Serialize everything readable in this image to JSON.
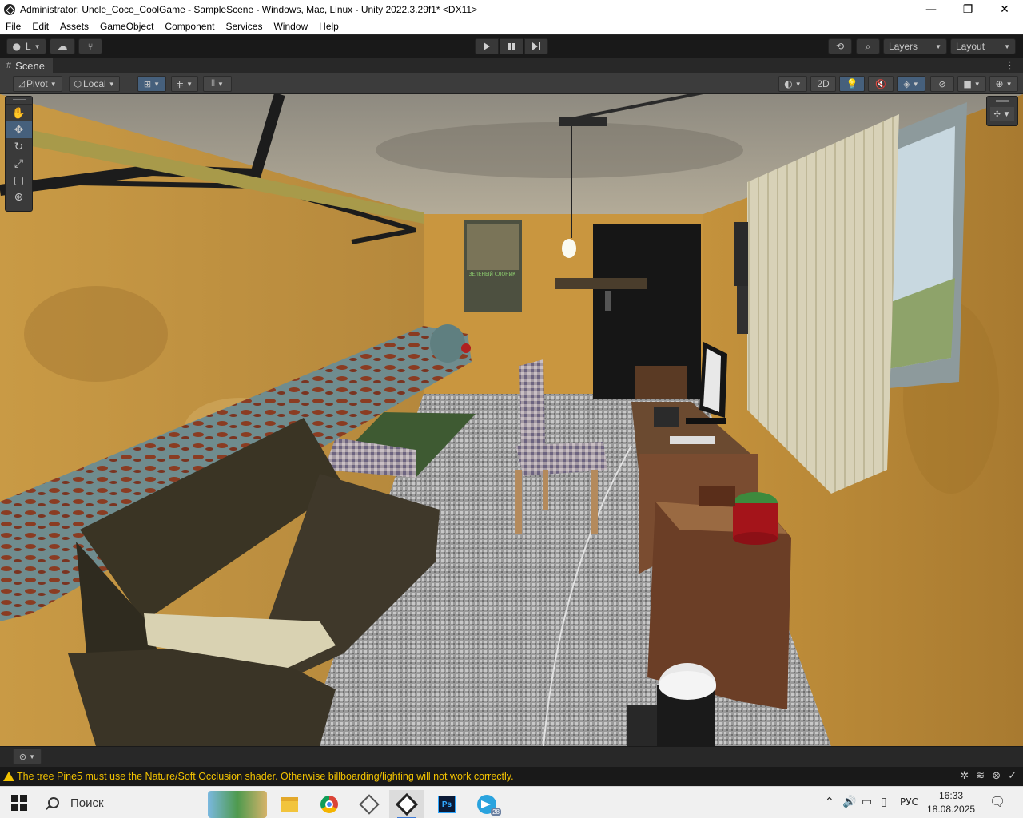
{
  "window": {
    "title": "Administrator: Uncle_Coco_CoolGame - SampleScene - Windows, Mac, Linux - Unity 2022.3.29f1* <DX11>",
    "minimize": "—",
    "maximize": "❐",
    "close": "✕"
  },
  "menu": [
    "File",
    "Edit",
    "Assets",
    "GameObject",
    "Component",
    "Services",
    "Window",
    "Help"
  ],
  "toolbar": {
    "account_label": "L",
    "layers_label": "Layers",
    "layout_label": "Layout"
  },
  "scene_tab": {
    "label": "Scene"
  },
  "scene_toolbar": {
    "pivot_label": "Pivot",
    "local_label": "Local",
    "mode_2d_label": "2D"
  },
  "status": {
    "warning": "The tree Pine5 must use the Nature/Soft Occlusion shader. Otherwise billboarding/lighting will not work correctly."
  },
  "taskbar": {
    "search_placeholder": "Поиск",
    "language": "РУС",
    "time": "16:33",
    "date": "18.08.2025",
    "telegram_badge": "28"
  },
  "scene": {
    "poster_text": "ЗЕЛЕНЫЙ СЛОНИК"
  },
  "colors": {
    "editor_dark": "#282828",
    "toolbar_dark": "#191919",
    "selected_blue": "#46607c",
    "warning_yellow": "#f2c200"
  }
}
